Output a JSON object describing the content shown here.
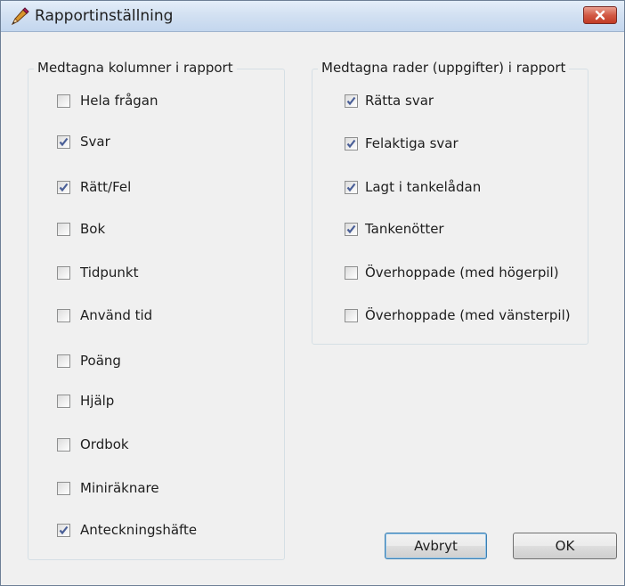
{
  "window": {
    "title": "Rapportinställning"
  },
  "columns_group": {
    "legend": "Medtagna kolumner i rapport",
    "items": [
      {
        "label": "Hela frågan",
        "checked": false
      },
      {
        "label": "Svar",
        "checked": true
      },
      {
        "label": "Rätt/Fel",
        "checked": true
      },
      {
        "label": "Bok",
        "checked": false
      },
      {
        "label": "Tidpunkt",
        "checked": false
      },
      {
        "label": "Använd tid",
        "checked": false
      },
      {
        "label": "Poäng",
        "checked": false
      },
      {
        "label": "Hjälp",
        "checked": false
      },
      {
        "label": "Ordbok",
        "checked": false
      },
      {
        "label": "Miniräknare",
        "checked": false
      },
      {
        "label": "Anteckningshäfte",
        "checked": true
      }
    ]
  },
  "rows_group": {
    "legend": "Medtagna rader (uppgifter) i rapport",
    "items": [
      {
        "label": "Rätta svar",
        "checked": true
      },
      {
        "label": "Felaktiga svar",
        "checked": true
      },
      {
        "label": "Lagt i tankelådan",
        "checked": true
      },
      {
        "label": "Tankenötter",
        "checked": true
      },
      {
        "label": "Överhoppade (med högerpil)",
        "checked": false
      },
      {
        "label": "Överhoppade (med vänsterpil)",
        "checked": false
      }
    ]
  },
  "buttons": {
    "cancel": "Avbryt",
    "ok": "OK"
  },
  "colors": {
    "check": "#4a5f97",
    "titlebar": "#d3e1f2",
    "close": "#c8412c"
  }
}
